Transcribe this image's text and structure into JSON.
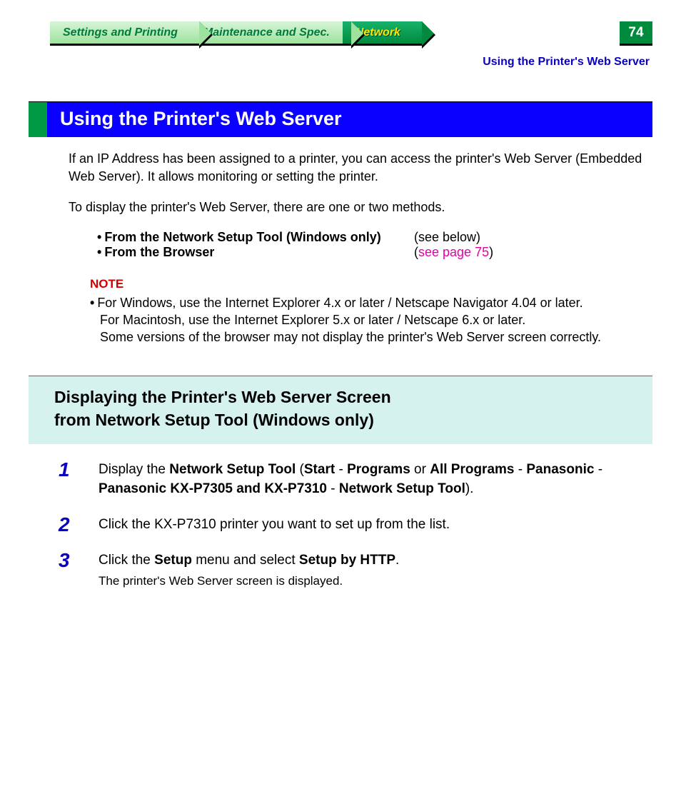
{
  "tabs": {
    "settings": "Settings and Printing",
    "maintenance": "Maintenance and Spec.",
    "network": "Network"
  },
  "page_number": "74",
  "breadcrumb": "Using the Printer's Web Server",
  "title": "Using the Printer's Web Server",
  "intro_p1": "If an IP Address has been assigned to a printer, you can access the printer's Web Server (Embedded Web Server). It allows monitoring or setting the printer.",
  "intro_p2": "To display the printer's Web Server, there are one or two methods.",
  "methods": [
    {
      "label": "From the Network Setup Tool (Windows only)",
      "aside_plain": "(see below)",
      "link": ""
    },
    {
      "label": "From the Browser",
      "aside_open": "(",
      "link": "see page 75",
      "aside_close": ")"
    }
  ],
  "note_label": "NOTE",
  "note_bullet": "•",
  "note_line1": "For Windows, use the Internet Explorer 4.x or later / Netscape Navigator 4.04 or later.",
  "note_line2": "For Macintosh, use the Internet Explorer 5.x or later / Netscape 6.x or later.",
  "note_line3": "Some versions of the browser may not display the printer's Web Server screen correctly.",
  "section_heading_l1": "Displaying the Printer's Web Server Screen",
  "section_heading_l2": "from Network Setup Tool (Windows only)",
  "steps": {
    "s1": {
      "num": "1",
      "pre": "Display the ",
      "b1": "Network Setup Tool",
      "t1": " (",
      "b2": "Start",
      "t2": " - ",
      "b3": "Programs",
      "t3": " or ",
      "b4": "All Programs",
      "t4": " - ",
      "b5": "Panasonic",
      "t5": " - ",
      "b6": "Panasonic KX-P7305 and KX-P7310",
      "t6": " - ",
      "b7": "Network Setup Tool",
      "t7": ")."
    },
    "s2": {
      "num": "2",
      "text": "Click the KX-P7310 printer you want to set up from the list."
    },
    "s3": {
      "num": "3",
      "pre": "Click the ",
      "b1": "Setup",
      "mid": " menu and select ",
      "b2": "Setup by HTTP",
      "post": ".",
      "sub": "The printer's Web Server screen is displayed."
    }
  }
}
